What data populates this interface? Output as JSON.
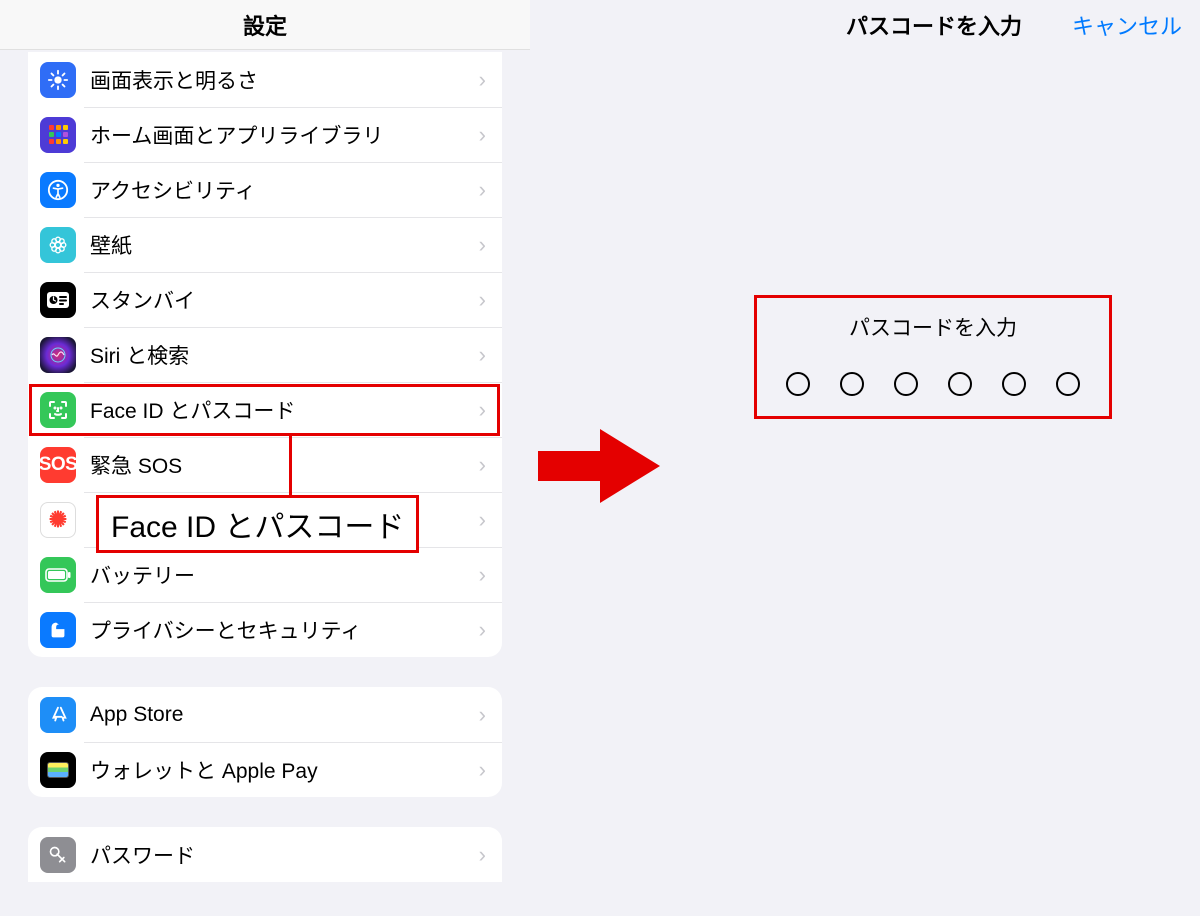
{
  "left": {
    "title": "設定",
    "groups": [
      {
        "rows": [
          {
            "id": "display",
            "label": "画面表示と明るさ"
          },
          {
            "id": "home",
            "label": "ホーム画面とアプリライブラリ"
          },
          {
            "id": "access",
            "label": "アクセシビリティ"
          },
          {
            "id": "wallpaper",
            "label": "壁紙"
          },
          {
            "id": "standby",
            "label": "スタンバイ"
          },
          {
            "id": "siri",
            "label": "Siri と検索"
          },
          {
            "id": "faceid",
            "label": "Face ID とパスコード"
          },
          {
            "id": "sos",
            "label": "緊急 SOS"
          },
          {
            "id": "exposure",
            "label": ""
          },
          {
            "id": "battery",
            "label": "バッテリー"
          },
          {
            "id": "privacy",
            "label": "プライバシーとセキュリティ"
          }
        ]
      },
      {
        "rows": [
          {
            "id": "appstore",
            "label": "App Store"
          },
          {
            "id": "wallet",
            "label": "ウォレットと Apple Pay"
          }
        ]
      },
      {
        "rows": [
          {
            "id": "passwords",
            "label": "パスワード"
          }
        ]
      }
    ]
  },
  "right": {
    "title": "パスコードを入力",
    "cancel": "キャンセル",
    "prompt": "パスコードを入力",
    "digits": 6
  },
  "callout": {
    "text": "Face ID とパスコード"
  },
  "sos_text": "SOS",
  "colors": {
    "highlight": "#e40000",
    "ios_blue": "#007aff"
  }
}
